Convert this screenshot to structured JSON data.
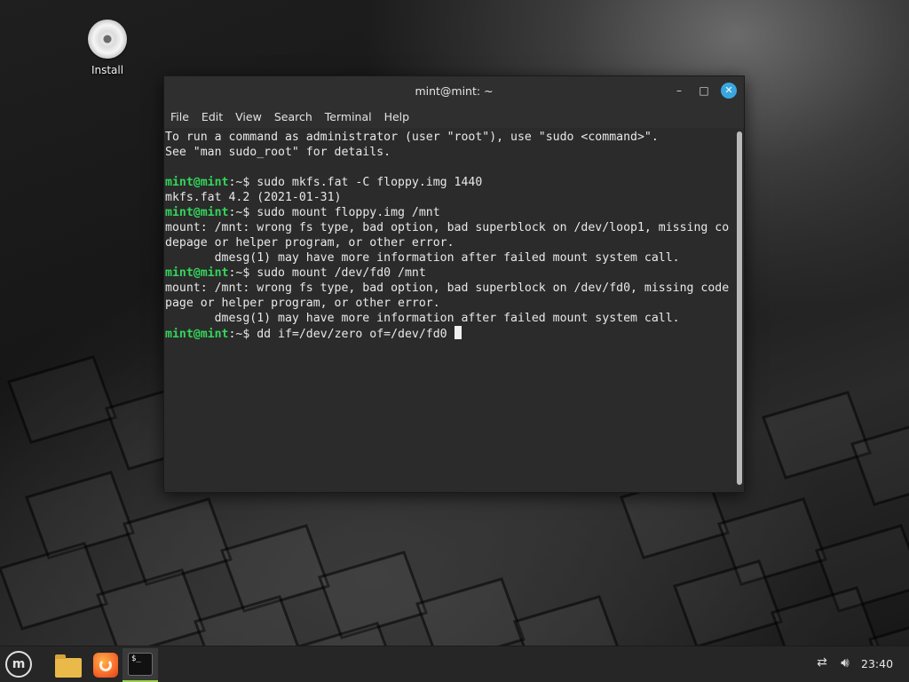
{
  "desktop": {
    "icons": [
      {
        "label": "Install",
        "icon": "disc-icon"
      }
    ]
  },
  "window": {
    "title": "mint@mint: ~",
    "controls": {
      "minimize": "–",
      "maximize": "□",
      "close": "✕"
    },
    "menu": [
      "File",
      "Edit",
      "View",
      "Search",
      "Terminal",
      "Help"
    ]
  },
  "terminal": {
    "lines": [
      {
        "prompt": "",
        "sep": "",
        "text": "To run a command as administrator (user \"root\"), use \"sudo <command>\"."
      },
      {
        "prompt": "",
        "sep": "",
        "text": "See \"man sudo_root\" for details."
      },
      {
        "prompt": "",
        "sep": "",
        "text": ""
      },
      {
        "prompt": "mint@mint",
        "sep": ":~$ ",
        "text": "sudo mkfs.fat -C floppy.img 1440"
      },
      {
        "prompt": "",
        "sep": "",
        "text": "mkfs.fat 4.2 (2021-01-31)"
      },
      {
        "prompt": "mint@mint",
        "sep": ":~$ ",
        "text": "sudo mount floppy.img /mnt"
      },
      {
        "prompt": "",
        "sep": "",
        "text": "mount: /mnt: wrong fs type, bad option, bad superblock on /dev/loop1, missing co"
      },
      {
        "prompt": "",
        "sep": "",
        "text": "depage or helper program, or other error."
      },
      {
        "prompt": "",
        "sep": "",
        "text": "       dmesg(1) may have more information after failed mount system call."
      },
      {
        "prompt": "mint@mint",
        "sep": ":~$ ",
        "text": "sudo mount /dev/fd0 /mnt"
      },
      {
        "prompt": "",
        "sep": "",
        "text": "mount: /mnt: wrong fs type, bad option, bad superblock on /dev/fd0, missing code"
      },
      {
        "prompt": "",
        "sep": "",
        "text": "page or helper program, or other error."
      },
      {
        "prompt": "",
        "sep": "",
        "text": "       dmesg(1) may have more information after failed mount system call."
      },
      {
        "prompt": "mint@mint",
        "sep": ":~$ ",
        "text": "dd if=/dev/zero of=/dev/fd0 ",
        "cursor": true
      }
    ]
  },
  "taskbar": {
    "menu_logo": "m",
    "apps": [
      "mint-menu-icon",
      "folder-icon",
      "firefox-icon",
      "terminal-icon"
    ],
    "terminal_glyph": "$_",
    "clock": "23:40"
  },
  "colors": {
    "prompt": "#33d65a",
    "close_button": "#3aa6e0",
    "active_indicator": "#9bd04d"
  }
}
